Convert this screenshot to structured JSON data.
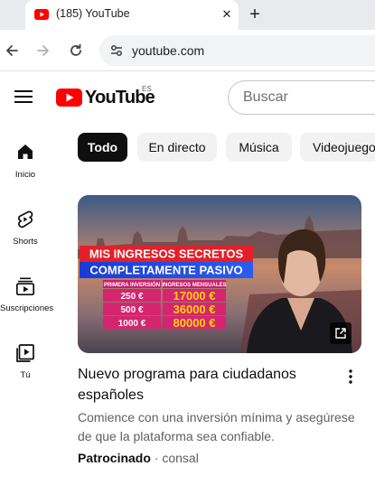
{
  "browser": {
    "tab_title": "(185) YouTube",
    "url": "youtube.com",
    "icons": [
      "youtube-favicon",
      "close-icon",
      "plus-icon",
      "back-arrow-icon",
      "forward-arrow-icon",
      "reload-icon",
      "site-info-icon"
    ]
  },
  "header": {
    "logo_text": "YouTube",
    "region": "ES",
    "search_placeholder": "Buscar",
    "brand_color": "#ff0000"
  },
  "sidebar": {
    "items": [
      {
        "label": "Inicio",
        "icon": "home-icon"
      },
      {
        "label": "Shorts",
        "icon": "shorts-icon"
      },
      {
        "label": "Suscripciones",
        "icon": "subscriptions-icon"
      },
      {
        "label": "Tú",
        "icon": "you-library-icon"
      }
    ]
  },
  "chips": [
    {
      "label": "Todo",
      "active": true
    },
    {
      "label": "En directo",
      "active": false
    },
    {
      "label": "Música",
      "active": false
    },
    {
      "label": "Videojuegos",
      "active": false
    }
  ],
  "video": {
    "thumbnail": {
      "headline_1": "MIS INGRESOS SECRETOS",
      "headline_2": "COMPLETAMENTE PASIVO",
      "col_1_header": "PRIMERA INVERSIÓN",
      "col_2_header": "INGRESOS MENSUALES",
      "rows": [
        {
          "investment": "250 €",
          "income": "17000 €"
        },
        {
          "investment": "500 €",
          "income": "36000 €"
        },
        {
          "investment": "1000 €",
          "income": "80000 €"
        }
      ]
    },
    "title": "Nuevo programa para ciudadanos españoles",
    "description": "Comience con una inversión mínima y asegúrese de que la plataforma sea confiable.",
    "sponsored_label": "Patrocinado",
    "separator": "·",
    "channel": "consal"
  }
}
